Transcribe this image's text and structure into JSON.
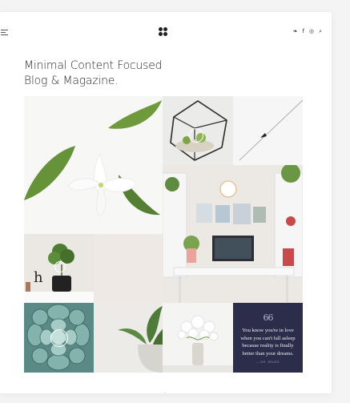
{
  "header": {
    "menu_icon": "hamburger-icon",
    "logo_icon": "four-dot-logo-icon",
    "social": [
      {
        "icon": "twitter-icon",
        "glyph": "❧"
      },
      {
        "icon": "facebook-icon",
        "glyph": "f"
      },
      {
        "icon": "instagram-icon",
        "glyph": "◎"
      },
      {
        "icon": "search-icon",
        "glyph": "⌕"
      }
    ]
  },
  "hero": {
    "title_line1": "Minimal Content Focused",
    "title_line2": "Blog & Magazine."
  },
  "quote": {
    "mark": "66",
    "text": "You know you're in love when you can't fall asleep because reality is finally better than your dreams.",
    "author": "— DR. SEUSS"
  },
  "colors": {
    "background": "#f4f4f5",
    "card": "#ffffff",
    "quote_bg": "#2c2d4a",
    "accent": "#c9cbe8"
  }
}
